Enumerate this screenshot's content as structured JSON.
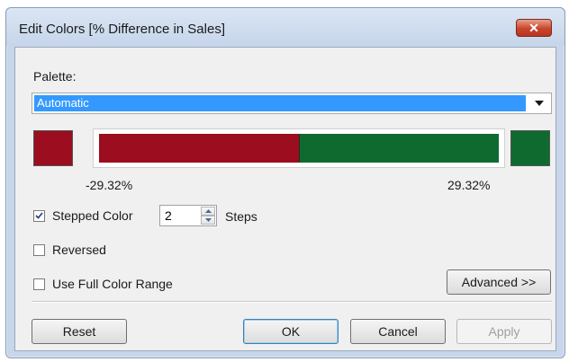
{
  "window": {
    "title": "Edit Colors [% Difference in Sales]",
    "close_label": "✕"
  },
  "palette": {
    "label": "Palette:",
    "selected": "Automatic"
  },
  "colors": {
    "negative": "#9b0d1f",
    "positive": "#0f6a30"
  },
  "range": {
    "min": "-29.32%",
    "max": "29.32%"
  },
  "options": {
    "stepped_color_label": "Stepped Color",
    "stepped_color_checked": true,
    "steps_value": "2",
    "steps_label": "Steps",
    "reversed_label": "Reversed",
    "reversed_checked": false,
    "full_range_label": "Use Full Color Range",
    "full_range_checked": false
  },
  "buttons": {
    "advanced": "Advanced >>",
    "reset": "Reset",
    "ok": "OK",
    "cancel": "Cancel",
    "apply": "Apply"
  },
  "icons": {
    "dropdown": "chevron-down-icon",
    "close": "close-icon",
    "check": "checkmark-icon",
    "spin_up": "spin-up-icon",
    "spin_down": "spin-down-icon"
  }
}
